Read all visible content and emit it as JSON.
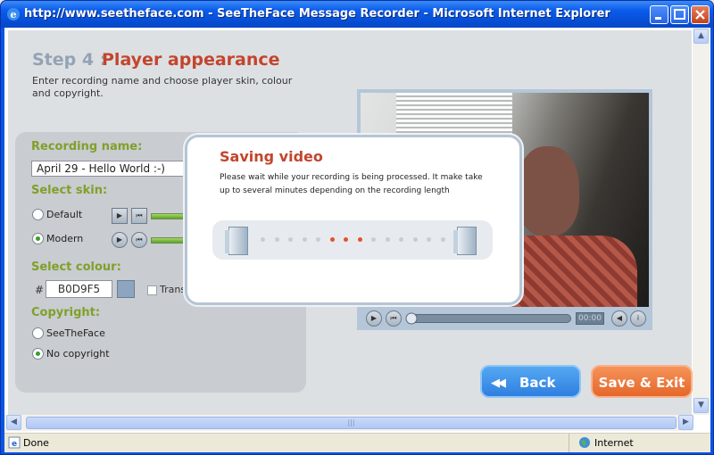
{
  "window": {
    "title": "http://www.seetheface.com - SeeTheFace Message Recorder - Microsoft Internet Explorer"
  },
  "step": {
    "number": "Step 4 :",
    "title": "Player appearance",
    "description": "Enter recording name and choose player skin, colour and copyright."
  },
  "form": {
    "recording_name_label": "Recording name:",
    "recording_name_value": "April 29 - Hello World :-)",
    "skin_label": "Select skin:",
    "skin_options": [
      {
        "label": "Default",
        "selected": false
      },
      {
        "label": "Modern",
        "selected": true
      }
    ],
    "colour_label": "Select colour:",
    "colour_hash": "#",
    "colour_value": "B0D9F5",
    "transparent_label": "Transparent",
    "copyright_label": "Copyright:",
    "copyright_options": [
      {
        "label": "SeeTheFace",
        "selected": false
      },
      {
        "label": "No copyright",
        "selected": true
      }
    ]
  },
  "video": {
    "time": "00:00"
  },
  "buttons": {
    "back": "Back",
    "save_exit": "Save & Exit"
  },
  "dialog": {
    "title": "Saving video",
    "message": "Please wait while your recording is being processed. It make take up to several minutes depending on the recording length",
    "dots_total": 14,
    "dots_active": [
      5,
      6,
      7
    ]
  },
  "status": {
    "left": "Done",
    "zone": "Internet"
  },
  "colors": {
    "accent_red": "#c2452d",
    "label_green": "#80a02a",
    "back_blue": "#2f7fe0",
    "save_orange": "#e5672a"
  }
}
